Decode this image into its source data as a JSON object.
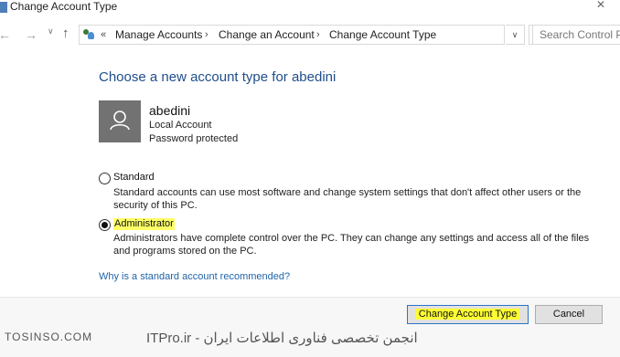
{
  "window": {
    "title": "Change Account Type",
    "close_glyph": "✕"
  },
  "nav": {
    "back_icon": "back-arrow-icon",
    "forward_icon": "forward-arrow-icon",
    "up_icon": "up-arrow-icon",
    "address_prefix": "«",
    "breadcrumb": [
      "Manage Accounts",
      "Change an Account",
      "Change Account Type"
    ],
    "separator": "›",
    "search_placeholder": "Search Control Pa"
  },
  "content": {
    "heading": "Choose a new account type for abedini",
    "account": {
      "name": "abedini",
      "type": "Local Account",
      "status": "Password protected"
    },
    "options": [
      {
        "label": "Standard",
        "selected": false,
        "desc1": "Standard accounts can use most software and change system settings that don't affect other users or the",
        "desc2": "security of this PC."
      },
      {
        "label": "Administrator",
        "selected": true,
        "desc1": "Administrators have complete control over the PC. They can change any settings and access all of the files",
        "desc2": "and programs stored on the PC."
      }
    ],
    "why_link": "Why is a standard account recommended?"
  },
  "footer": {
    "primary_button": "Change Account Type",
    "cancel_button": "Cancel"
  },
  "watermark": {
    "left": "TOSINSO.COM",
    "right": "ITPro.ir - انجمن تخصصی فناوری اطلاعات ایران"
  },
  "colors": {
    "heading": "#1f4e8c",
    "link": "#1f63a8",
    "highlight": "#ffff33",
    "avatar_bg": "#727272"
  }
}
